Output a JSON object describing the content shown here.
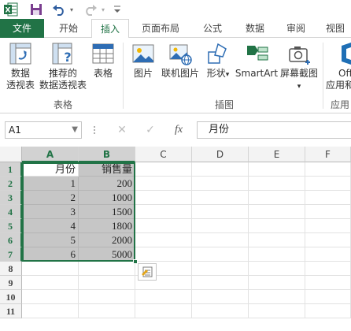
{
  "quick_access": {
    "icons": [
      "excel-logo-icon",
      "save-icon",
      "undo-icon",
      "redo-icon",
      "customize-qat-icon"
    ]
  },
  "tabs": [
    {
      "label": "文件"
    },
    {
      "label": "开始"
    },
    {
      "label": "插入",
      "active": true
    },
    {
      "label": "页面布局"
    },
    {
      "label": "公式"
    },
    {
      "label": "数据"
    },
    {
      "label": "审阅"
    },
    {
      "label": "视图"
    }
  ],
  "ribbon": {
    "pivot_table": {
      "line1": "数据",
      "line2": "透视表"
    },
    "recommended_pivot": {
      "line1": "推荐的",
      "line2": "数据透视表"
    },
    "table": {
      "label": "表格"
    },
    "group_tables": "表格",
    "picture": {
      "label": "图片"
    },
    "online_picture": {
      "label": "联机图片"
    },
    "shapes": {
      "label": "形状"
    },
    "smartart": {
      "label": "SmartArt"
    },
    "screenshot": {
      "label": "屏幕截图"
    },
    "office_apps": {
      "line1": "Off",
      "line2": "应用和"
    },
    "group_illustrations": "插图",
    "group_apps": "应用"
  },
  "formula_bar": {
    "name_box": "A1",
    "fx_label": "fx",
    "content": "月份"
  },
  "columns": [
    "A",
    "B",
    "C",
    "D",
    "E",
    "F"
  ],
  "rows": [
    "1",
    "2",
    "3",
    "4",
    "5",
    "6",
    "7",
    "8",
    "9",
    "10",
    "11"
  ],
  "table": {
    "headers": [
      "月份",
      "销售量"
    ],
    "data": [
      [
        "1",
        "200"
      ],
      [
        "2",
        "1000"
      ],
      [
        "3",
        "1500"
      ],
      [
        "4",
        "1800"
      ],
      [
        "5",
        "2000"
      ],
      [
        "6",
        "5000"
      ]
    ]
  },
  "colors": {
    "accent": "#217346",
    "selection_fill": "#c6c6c6"
  }
}
